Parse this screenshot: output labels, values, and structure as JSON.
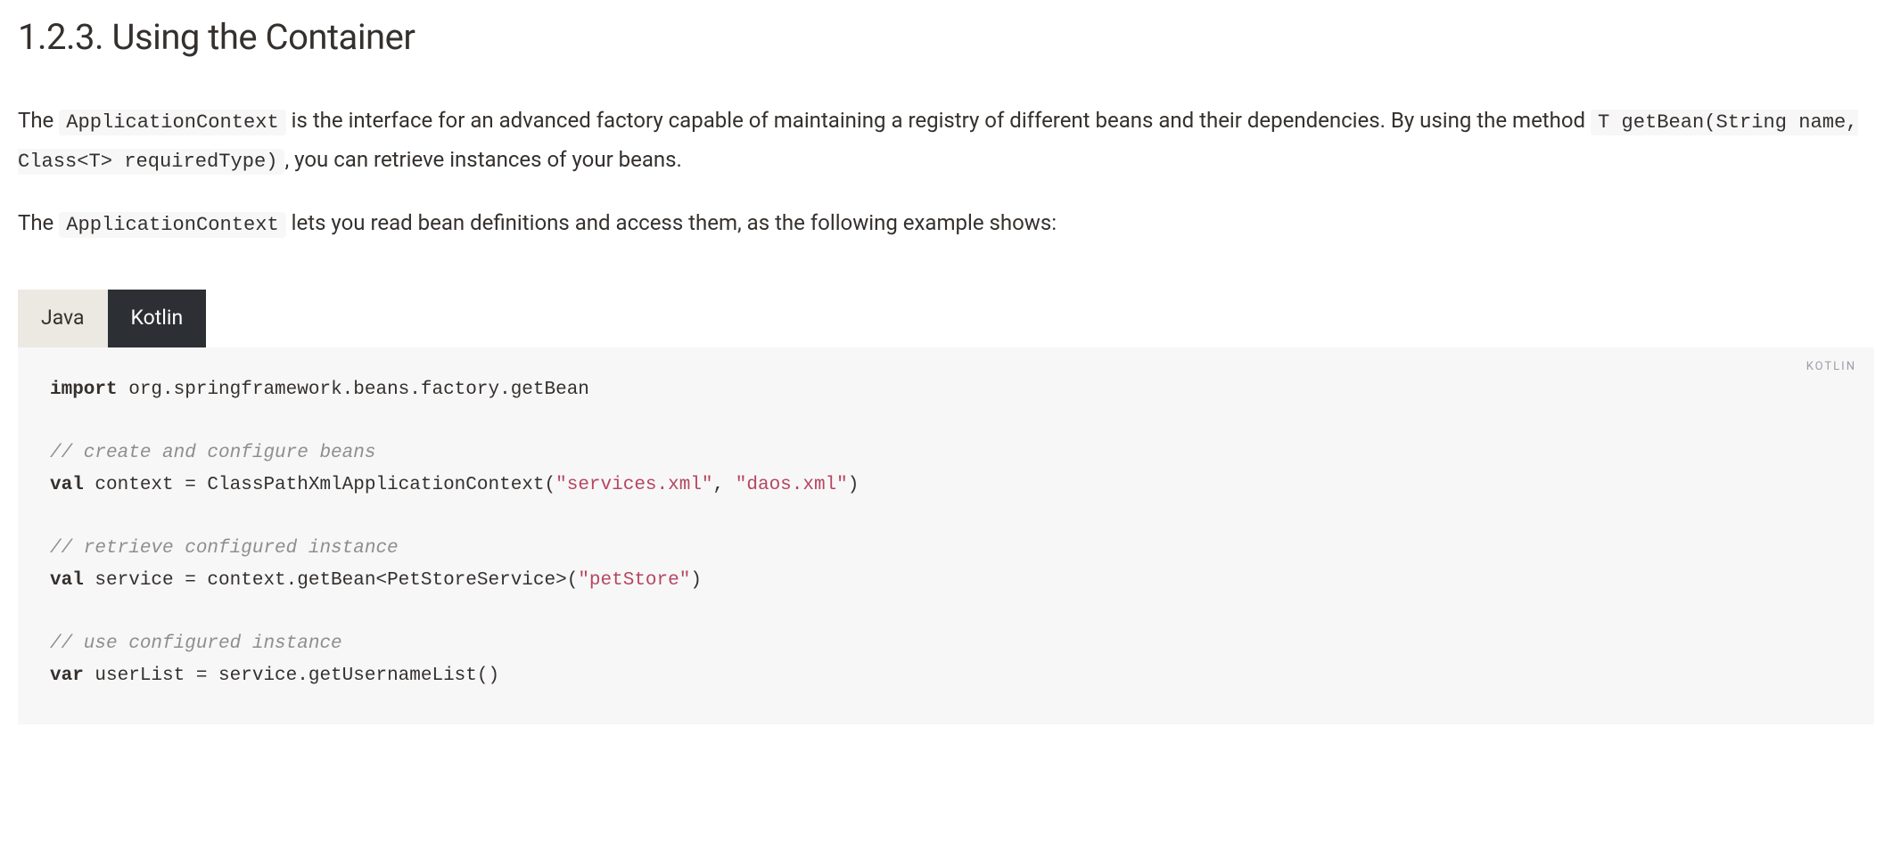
{
  "heading": "1.2.3. Using the Container",
  "para1": {
    "t1": "The ",
    "c1": "ApplicationContext",
    "t2": " is the interface for an advanced factory capable of maintaining a registry of different beans and their dependencies. By using the method ",
    "c2": "T getBean(String name, Class<T> requiredType)",
    "t3": ", you can retrieve instances of your beans."
  },
  "para2": {
    "t1": "The ",
    "c1": "ApplicationContext",
    "t2": " lets you read bean definitions and access them, as the following example shows:"
  },
  "tabs": {
    "java": "Java",
    "kotlin": "Kotlin"
  },
  "lang_badge": "KOTLIN",
  "code": {
    "l1_kw": "import",
    "l1_rest": " org.springframework.beans.factory.getBean",
    "l3_cmt": "// create and configure beans",
    "l4_kw": "val",
    "l4_a": " context = ClassPathXmlApplicationContext(",
    "l4_s1": "\"services.xml\"",
    "l4_b": ", ",
    "l4_s2": "\"daos.xml\"",
    "l4_c": ")",
    "l6_cmt": "// retrieve configured instance",
    "l7_kw": "val",
    "l7_a": " service = context.getBean<PetStoreService>(",
    "l7_s1": "\"petStore\"",
    "l7_b": ")",
    "l9_cmt": "// use configured instance",
    "l10_kw": "var",
    "l10_a": " userList = service.getUsernameList()"
  }
}
